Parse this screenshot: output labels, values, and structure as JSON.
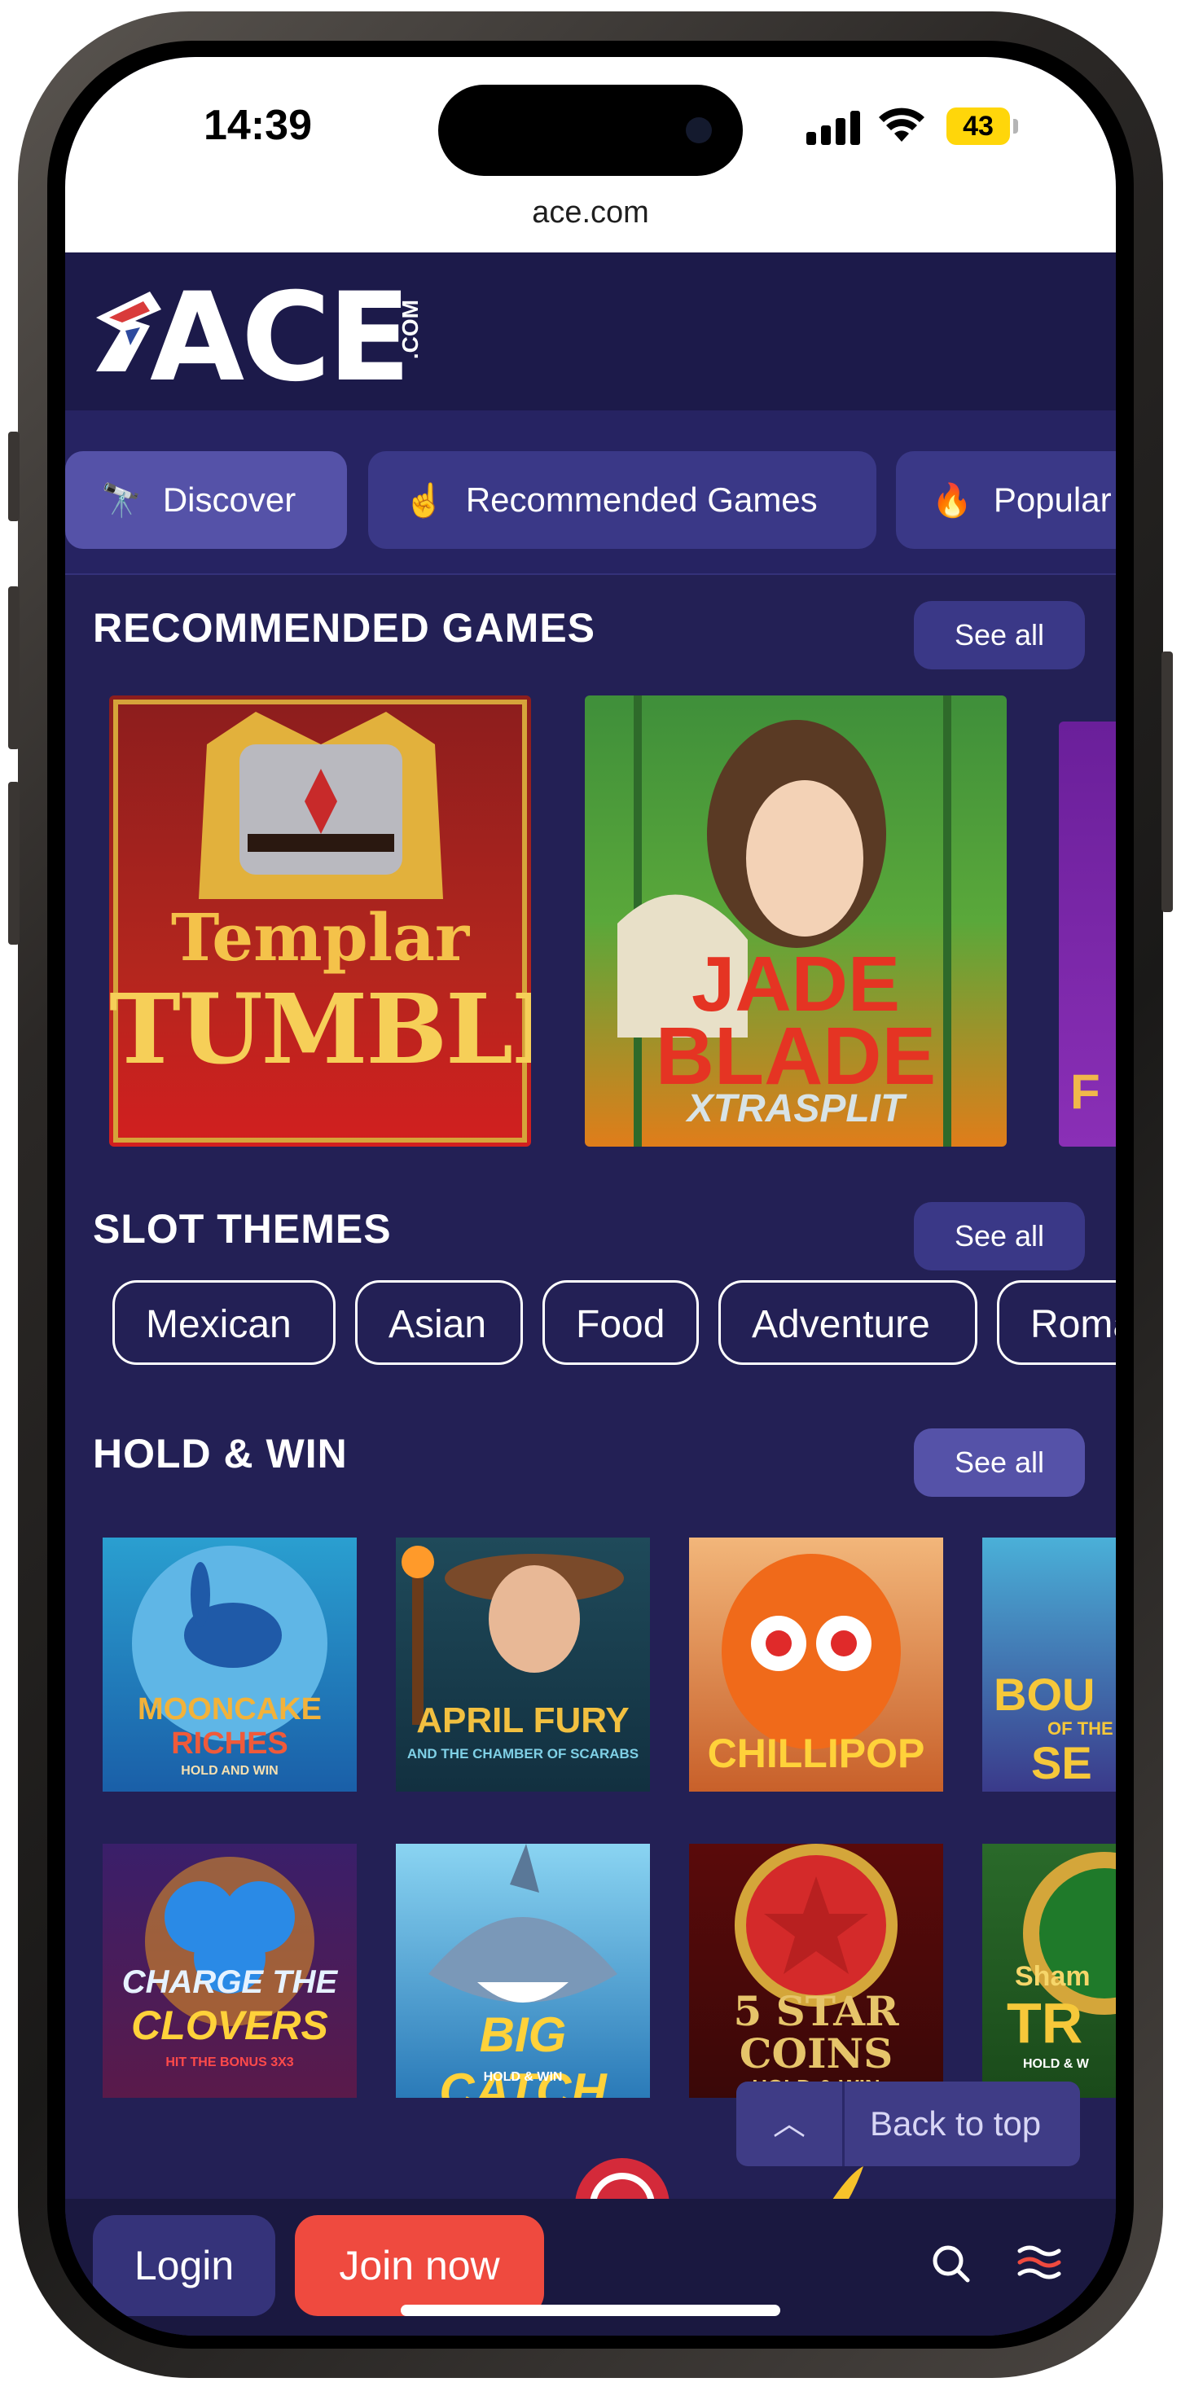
{
  "status_bar": {
    "time": "14:39",
    "battery": "43",
    "url": "ace.com"
  },
  "brand": {
    "logo_text": "ACE",
    "logo_suffix": ".COM"
  },
  "tabs": [
    {
      "label": "Discover",
      "icon": "telescope-icon"
    },
    {
      "label": "Recommended Games",
      "icon": "hand-pointer-icon"
    },
    {
      "label": "Popular",
      "icon": "flame-icon"
    }
  ],
  "sections": {
    "recommended": {
      "title": "RECOMMENDED GAMES",
      "see_all": "See all",
      "games": [
        {
          "line1": "Templar",
          "line2": "TUMBLE"
        },
        {
          "line1": "JADE",
          "line2": "BLADE",
          "line3": "XTRASPLIT"
        },
        {
          "line1": "F"
        }
      ]
    },
    "themes": {
      "title": "SLOT THEMES",
      "see_all": "See all",
      "chips": [
        "Mexican",
        "Asian",
        "Food",
        "Adventure",
        "Roma"
      ]
    },
    "hold_win": {
      "title": "HOLD & WIN",
      "see_all": "See all",
      "row1": [
        {
          "line1": "MOONCAKE",
          "line2": "RICHES",
          "line3": "HOLD AND WIN"
        },
        {
          "line1": "APRIL FURY",
          "line2": "AND THE CHAMBER OF SCARABS"
        },
        {
          "line1": "CHILLIPOP"
        },
        {
          "line1": "BOU",
          "line2": "OF THE",
          "line3": "SE"
        }
      ],
      "row2": [
        {
          "line1": "CHARGE THE",
          "line2": "CLOVERS",
          "line3": "HIT THE BONUS 3X3"
        },
        {
          "line1": "BIG CATCH",
          "line2": "HOLD & WIN"
        },
        {
          "line1": "5 STAR",
          "line2": "COINS",
          "line3": "HOLD & WIN"
        },
        {
          "line1": "Sham",
          "line2": "TR",
          "line3": "HOLD & W"
        }
      ]
    }
  },
  "back_to_top": "Back to top",
  "bottom_bar": {
    "login": "Login",
    "join": "Join now"
  },
  "colors": {
    "background": "#232055",
    "header": "#1c1a4a",
    "accent": "#ef4a3f",
    "button": "#3a3887"
  }
}
